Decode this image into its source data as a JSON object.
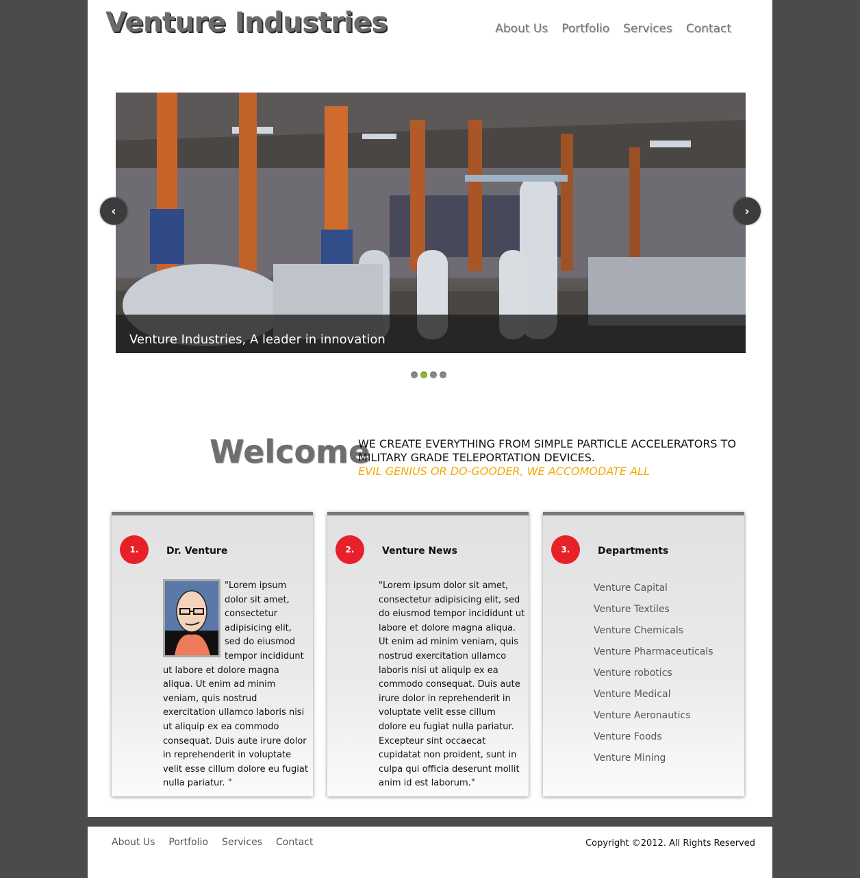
{
  "header": {
    "logo": "Venture Industries",
    "nav": [
      "About Us",
      "Portfolio",
      "Services",
      "Contact"
    ]
  },
  "slider": {
    "caption": "Venture Industries, A leader in innovation",
    "prev_icon": "chevron-left-icon",
    "next_icon": "chevron-right-icon",
    "prev_glyph": "‹",
    "next_glyph": "›",
    "dot_count": 4,
    "active_dot": 2
  },
  "welcome": {
    "title": "Welcome",
    "line1": "WE CREATE EVERYTHING FROM SIMPLE PARTICLE ACCELERATORS TO MILITARY GRADE TELEPORTATION DEVICES.",
    "line2": "EVIL GENIUS OR DO-GOODER, WE ACCOMODATE ALL"
  },
  "boxes": [
    {
      "num": "1.",
      "title": "Dr. Venture",
      "text": "\"Lorem ipsum dolor sit amet, consectetur adipisicing elit, sed do eiusmod tempor incididunt ut labore et dolore magna aliqua. Ut enim ad minim veniam, quis nostrud exercitation ullamco laboris nisi ut aliquip ex ea commodo consequat. Duis aute irure dolor in reprehenderit in voluptate velit esse cillum dolore eu fugiat nulla pariatur. \""
    },
    {
      "num": "2.",
      "title": "Venture News",
      "text": "\"Lorem ipsum dolor sit amet, consectetur adipisicing elit, sed do eiusmod tempor incididunt ut labore et dolore magna aliqua. Ut enim ad minim veniam, quis nostrud exercitation ullamco laboris nisi ut aliquip ex ea commodo consequat. Duis aute irure dolor in reprehenderit in voluptate velit esse cillum dolore eu fugiat nulla pariatur. Excepteur sint occaecat cupidatat non proident, sunt in culpa qui officia deserunt mollit anim id est laborum.\""
    },
    {
      "num": "3.",
      "title": "Departments",
      "items": [
        "Venture Capital",
        "Venture Textiles",
        "Venture Chemicals",
        "Venture Pharmaceuticals",
        "Venture robotics",
        "Venture Medical",
        "Venture Aeronautics",
        "Venture Foods",
        "Venture Mining"
      ]
    }
  ],
  "footer": {
    "nav": [
      "About Us",
      "Portfolio",
      "Services",
      "Contact"
    ],
    "copyright": "Copyright ©2012. All Rights Reserved"
  },
  "colors": {
    "background": "#4b4b4b",
    "badge": "#e8202a",
    "accent_text": "#f2a900",
    "active_dot": "#8db82a"
  }
}
